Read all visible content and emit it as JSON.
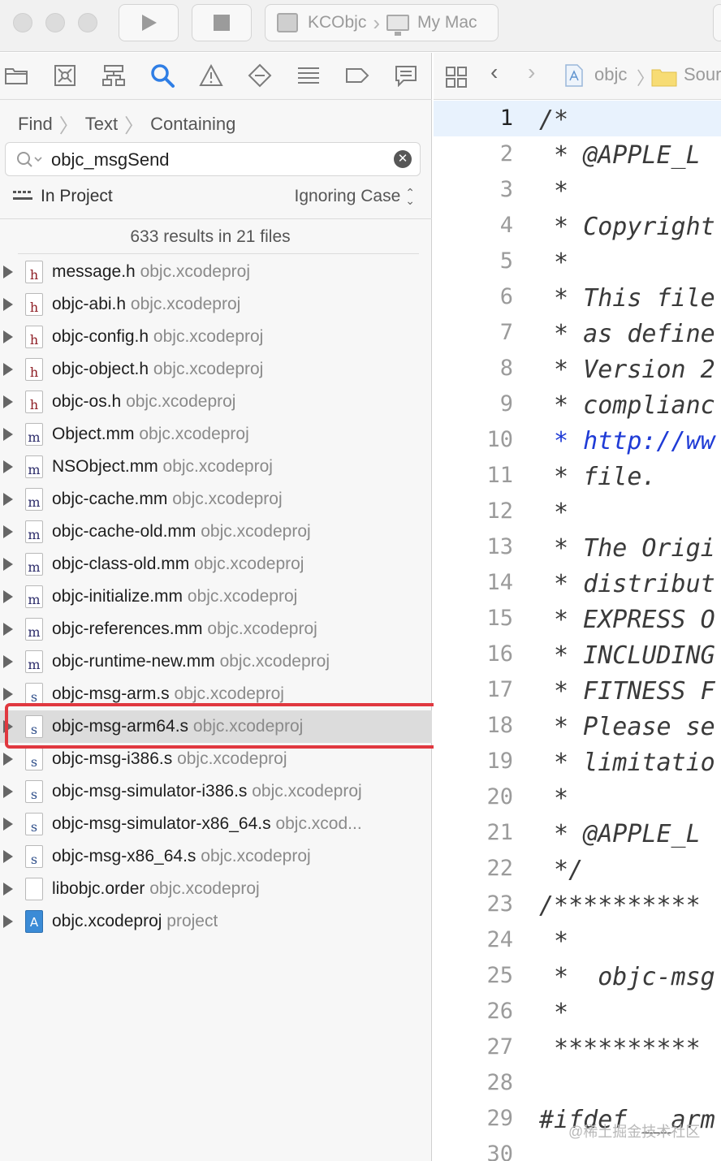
{
  "toolbar": {
    "scheme_name": "KCObjc",
    "destination": "My Mac"
  },
  "navigator": {
    "tabs": [
      "project-navigator",
      "source-control-navigator",
      "symbol-navigator",
      "find-navigator",
      "issue-navigator",
      "test-navigator",
      "debug-navigator",
      "breakpoint-navigator",
      "report-navigator"
    ],
    "breadcrumb": [
      "Find",
      "Text",
      "Containing"
    ],
    "search_value": "objc_msgSend",
    "scope": "In Project",
    "case_option": "Ignoring Case",
    "summary": "633 results in 21 files",
    "results": [
      {
        "name": "message.h",
        "project": "objc.xcodeproj",
        "type": "h"
      },
      {
        "name": "objc-abi.h",
        "project": "objc.xcodeproj",
        "type": "h"
      },
      {
        "name": "objc-config.h",
        "project": "objc.xcodeproj",
        "type": "h"
      },
      {
        "name": "objc-object.h",
        "project": "objc.xcodeproj",
        "type": "h"
      },
      {
        "name": "objc-os.h",
        "project": "objc.xcodeproj",
        "type": "h"
      },
      {
        "name": "Object.mm",
        "project": "objc.xcodeproj",
        "type": "m"
      },
      {
        "name": "NSObject.mm",
        "project": "objc.xcodeproj",
        "type": "m"
      },
      {
        "name": "objc-cache.mm",
        "project": "objc.xcodeproj",
        "type": "m"
      },
      {
        "name": "objc-cache-old.mm",
        "project": "objc.xcodeproj",
        "type": "m"
      },
      {
        "name": "objc-class-old.mm",
        "project": "objc.xcodeproj",
        "type": "m"
      },
      {
        "name": "objc-initialize.mm",
        "project": "objc.xcodeproj",
        "type": "m"
      },
      {
        "name": "objc-references.mm",
        "project": "objc.xcodeproj",
        "type": "m"
      },
      {
        "name": "objc-runtime-new.mm",
        "project": "objc.xcodeproj",
        "type": "m"
      },
      {
        "name": "objc-msg-arm.s",
        "project": "objc.xcodeproj",
        "type": "s"
      },
      {
        "name": "objc-msg-arm64.s",
        "project": "objc.xcodeproj",
        "type": "s",
        "selected": true
      },
      {
        "name": "objc-msg-i386.s",
        "project": "objc.xcodeproj",
        "type": "s"
      },
      {
        "name": "objc-msg-simulator-i386.s",
        "project": "objc.xcodeproj",
        "type": "s"
      },
      {
        "name": "objc-msg-simulator-x86_64.s",
        "project": "objc.xcod...",
        "type": "s"
      },
      {
        "name": "objc-msg-x86_64.s",
        "project": "objc.xcodeproj",
        "type": "s"
      },
      {
        "name": "libobjc.order",
        "project": "objc.xcodeproj",
        "type": "plain"
      },
      {
        "name": "objc.xcodeproj",
        "project": "project",
        "type": "proj"
      }
    ]
  },
  "editor": {
    "jumpbar": [
      "objc",
      "Sour"
    ],
    "current_line": 1,
    "lines": [
      {
        "n": "1",
        "t": "/*"
      },
      {
        "n": "2",
        "t": " * @APPLE_L"
      },
      {
        "n": "3",
        "t": " *"
      },
      {
        "n": "4",
        "t": " * Copyright"
      },
      {
        "n": "5",
        "t": " *"
      },
      {
        "n": "6",
        "t": " * This file"
      },
      {
        "n": "7",
        "t": " * as define"
      },
      {
        "n": "8",
        "t": " * Version 2"
      },
      {
        "n": "9",
        "t": " * complianc"
      },
      {
        "n": "10",
        "t": " * http://ww",
        "link": true
      },
      {
        "n": "11",
        "t": " * file."
      },
      {
        "n": "12",
        "t": " *"
      },
      {
        "n": "13",
        "t": " * The Origi"
      },
      {
        "n": "14",
        "t": " * distribut"
      },
      {
        "n": "15",
        "t": " * EXPRESS O"
      },
      {
        "n": "16",
        "t": " * INCLUDING"
      },
      {
        "n": "17",
        "t": " * FITNESS F"
      },
      {
        "n": "18",
        "t": " * Please se"
      },
      {
        "n": "19",
        "t": " * limitatio"
      },
      {
        "n": "20",
        "t": " *"
      },
      {
        "n": "21",
        "t": " * @APPLE_L"
      },
      {
        "n": "22",
        "t": " */"
      },
      {
        "n": "23",
        "t": "/**********"
      },
      {
        "n": "24",
        "t": " *"
      },
      {
        "n": "25",
        "t": " *  objc-msg"
      },
      {
        "n": "26",
        "t": " *"
      },
      {
        "n": "27",
        "t": " **********"
      },
      {
        "n": "28",
        "t": ""
      },
      {
        "n": "29",
        "t": "#ifdef __arm"
      },
      {
        "n": "30",
        "t": ""
      }
    ]
  },
  "watermark": "@稀土掘金技术社区"
}
